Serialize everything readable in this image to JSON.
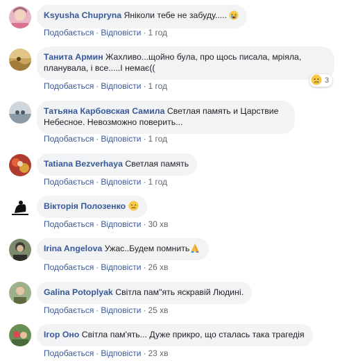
{
  "labels": {
    "like": "Подобається",
    "reply": "Відповісти",
    "sep": "·"
  },
  "comments": [
    {
      "author": "Ksyusha Chupryna",
      "text": "Яніколи тебе не забуду.....",
      "time": "1 год"
    },
    {
      "author": "Танита Армин",
      "text": "Жахливо...щойно була, про щось писала, мріяла, планувала, і все.....І немає((",
      "time": "1 год",
      "reaction_count": "3"
    },
    {
      "author": "Татьяна Карбовская Самила",
      "text": "Светлая память и Царствие Небесное. Невозможно поверить...",
      "time": "1 год"
    },
    {
      "author": "Tatiana Bezverhaya",
      "text": "Светлая память",
      "time": "1 год"
    },
    {
      "author": "Вікторія Полозенко",
      "text": "",
      "time": "30 хв"
    },
    {
      "author": "Irina Angelova",
      "text": "Ужас..Будем помнить",
      "time": "26 хв"
    },
    {
      "author": "Galina Potoplyak",
      "text": "Світла пам\"ять яскравій Людині.",
      "time": "25 хв"
    },
    {
      "author": "Ігор Оно",
      "text": "Світла пам'ять... Дуже прикро, що сталась така трагедія",
      "time": "23 хв"
    }
  ]
}
